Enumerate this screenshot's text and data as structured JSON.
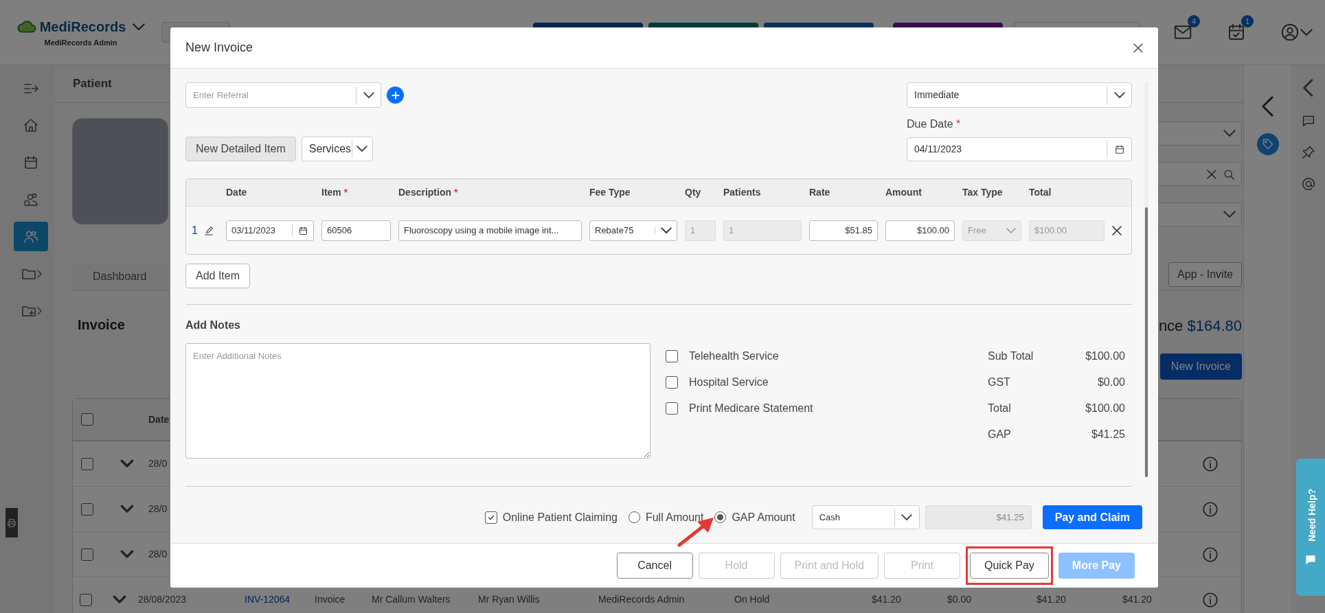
{
  "app_bar": {
    "logo": "MediRecords",
    "subtitle": "MediRecords Admin",
    "notifications": [
      {
        "kind": "mail",
        "count": "4"
      },
      {
        "kind": "tasks",
        "count": "1"
      }
    ]
  },
  "sidebar": {
    "items": [
      {
        "kind": "collapse",
        "selected": false
      },
      {
        "kind": "home",
        "selected": false
      },
      {
        "kind": "calendar",
        "selected": false
      },
      {
        "kind": "billing",
        "selected": false
      },
      {
        "kind": "patients",
        "selected": true
      },
      {
        "kind": "folder",
        "selected": false
      },
      {
        "kind": "folder-add",
        "selected": false
      }
    ]
  },
  "page": {
    "title": "Patient",
    "tabs": [
      {
        "label": "Dashboard",
        "selected": false
      }
    ],
    "app_invite": "App - Invite",
    "section_title": "Invoice",
    "balance_label": "nce",
    "balance": "$164.80",
    "new_invoice": "New Invoice",
    "table": {
      "select_all_checked": false,
      "columns": [
        "Date"
      ],
      "rows": [
        {
          "checked": false,
          "cells": [
            "28/0"
          ]
        },
        {
          "checked": false,
          "cells": [
            "28/0"
          ]
        },
        {
          "checked": false,
          "cells": [
            "28/0"
          ]
        },
        {
          "checked": false,
          "cells": [
            "28/08/2023",
            "INV-12064",
            "Invoice",
            "Mr Callum Walters",
            "Mr Ryan Willis",
            "MediRecords Admin",
            "On Hold",
            "$41.20",
            "$0.00",
            "$41.20",
            "$41.20"
          ]
        }
      ]
    }
  },
  "annotations": {
    "arrow": true
  },
  "help_tab": {
    "label": "Need Help?"
  },
  "modal": {
    "title": "New Invoice",
    "referral_placeholder": "Enter Referral",
    "timing": "Immediate",
    "due_date_label": "Due Date",
    "due_date_mark": "*",
    "due_date": "04/11/2023",
    "detail_button": "New Detailed Item",
    "services": "Services",
    "items": {
      "columns": [
        {
          "label": "Date"
        },
        {
          "label": "Item",
          "required_mark": "*"
        },
        {
          "label": "Description",
          "required_mark": "*"
        },
        {
          "label": "Fee Type"
        },
        {
          "label": "Qty"
        },
        {
          "label": "Patients"
        },
        {
          "label": "Rate"
        },
        {
          "label": "Amount"
        },
        {
          "label": "Tax Type"
        },
        {
          "label": "Total"
        }
      ],
      "rows": [
        {
          "number": "1",
          "date": "03/11/2023",
          "item": "60506",
          "description": "Fluoroscopy using a mobile image int...",
          "fee_type": "Rebate75",
          "qty": "1",
          "patients": "1",
          "rate": "$51.85",
          "amount": "$100.00",
          "tax_type": "Free",
          "total": "$100.00"
        }
      ]
    },
    "add_item": "Add Item",
    "notes_label": "Add Notes",
    "notes_placeholder": "Enter Additional Notes",
    "options": [
      {
        "label": "Telehealth Service",
        "checked": false
      },
      {
        "label": "Hospital Service",
        "checked": false
      },
      {
        "label": "Print Medicare Statement",
        "checked": false
      }
    ],
    "totals": [
      {
        "label": "Sub Total",
        "value": "$100.00"
      },
      {
        "label": "GST",
        "value": "$0.00"
      },
      {
        "label": "Total",
        "value": "$100.00"
      },
      {
        "label": "GAP",
        "value": "$41.25"
      }
    ],
    "payment": {
      "online_claiming": {
        "label": "Online Patient Claiming",
        "checked": true
      },
      "radios": [
        {
          "label": "Full Amount",
          "selected": false
        },
        {
          "label": "GAP Amount",
          "selected": true
        }
      ],
      "method": "Cash",
      "amount": "$41.25",
      "pay_button": "Pay and Claim"
    },
    "footer_buttons": [
      {
        "label": "Cancel",
        "kind": "outline",
        "disabled": false,
        "highlighted": false
      },
      {
        "label": "Hold",
        "kind": "outline",
        "disabled": true,
        "highlighted": false
      },
      {
        "label": "Print and Hold",
        "kind": "outline",
        "disabled": true,
        "highlighted": false
      },
      {
        "label": "Print",
        "kind": "outline",
        "disabled": true,
        "highlighted": false
      },
      {
        "label": "Quick Pay",
        "kind": "outline",
        "disabled": false,
        "highlighted": true
      },
      {
        "label": "More Pay",
        "kind": "primary",
        "disabled": true,
        "highlighted": false
      }
    ]
  }
}
